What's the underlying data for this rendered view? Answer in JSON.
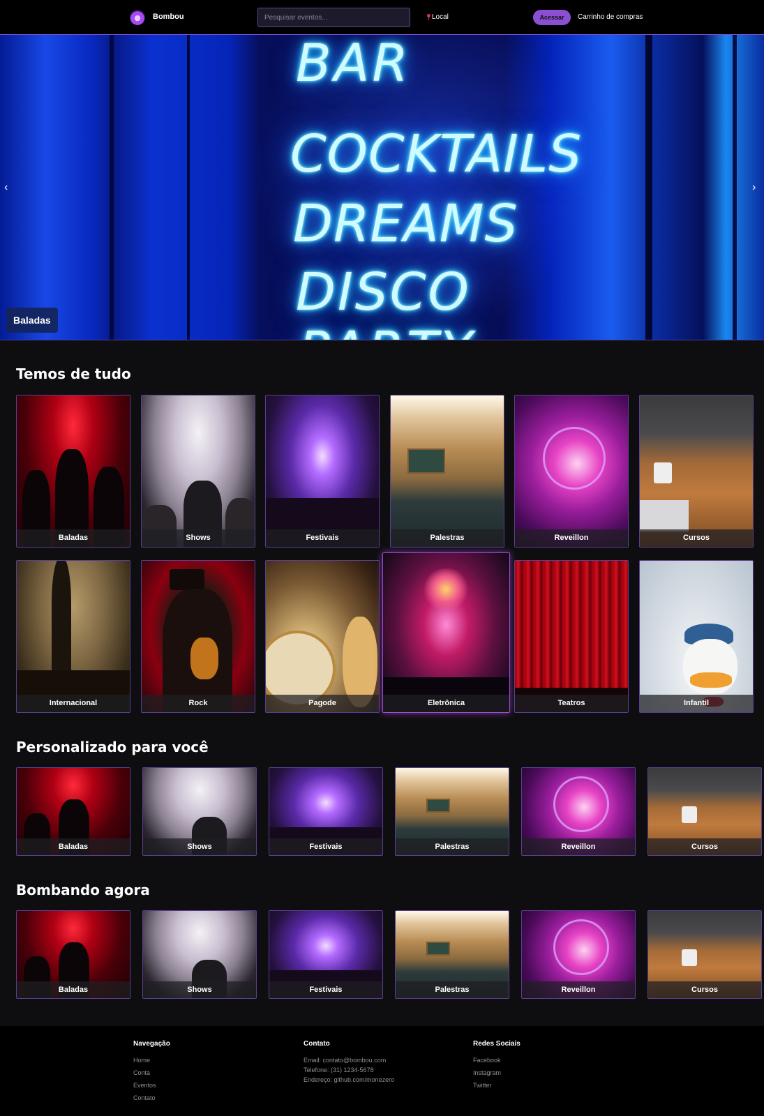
{
  "header": {
    "brand": "Bombou",
    "search_placeholder": "Pesquisar eventos...",
    "location_label": "Local",
    "login_label": "Acessar",
    "cart_label": "Carrinho de compras",
    "accent_color": "#8c4fd3"
  },
  "hero": {
    "neon_lines": [
      "BAR",
      "COCKTAILS",
      "DREAMS",
      "DISCO",
      "PARTY"
    ],
    "caption": "Baladas",
    "prev_icon": "‹",
    "next_icon": "›"
  },
  "sections": {
    "temos_de_tudo": {
      "title": "Temos de tudo",
      "row1": [
        "Baladas",
        "Shows",
        "Festivais",
        "Palestras",
        "Reveillon",
        "Cursos"
      ],
      "row2": [
        "Internacional",
        "Rock",
        "Pagode",
        "Eletrônica",
        "Teatros",
        "Infantil"
      ]
    },
    "personalizado": {
      "title": "Personalizado para você",
      "items": [
        "Baladas",
        "Shows",
        "Festivais",
        "Palestras",
        "Reveillon",
        "Cursos"
      ]
    },
    "bombando": {
      "title": "Bombando agora",
      "items": [
        "Baladas",
        "Shows",
        "Festivais",
        "Palestras",
        "Reveillon",
        "Cursos"
      ]
    }
  },
  "footer": {
    "nav": {
      "title": "Navegação",
      "links": [
        "Home",
        "Conta",
        "Eventos",
        "Contato"
      ]
    },
    "contact": {
      "title": "Contato",
      "email": "Email: contato@bombou.com",
      "phone": "Telefone: (31) 1234-5678",
      "address": "Endereço: github.com/monezero"
    },
    "social": {
      "title": "Redes Sociais",
      "links": [
        "Facebook",
        "Instagram",
        "Twitter"
      ]
    }
  }
}
